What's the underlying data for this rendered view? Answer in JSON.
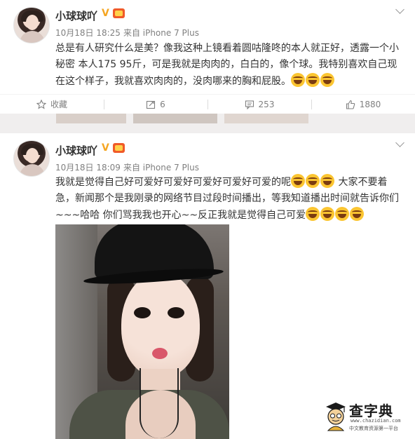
{
  "posts": [
    {
      "username": "小球球吖",
      "time": "10月18日 18:25",
      "source": "来自 iPhone 7 Plus",
      "text": "总是有人研究什么是美？像我这种上镜看着圆咕隆咚的本人就正好，透露一个小秘密 本人175 95斤，可是我就是肉肉的，白白的，像个球。我特别喜欢自己现在这个样子，我就喜欢肉肉的，没肉哪来的胸和屁股。",
      "emoji_count": 3,
      "actions": {
        "favorite": "收藏",
        "repost": "6",
        "comment": "253",
        "like": "1880"
      }
    },
    {
      "username": "小球球吖",
      "time": "10月18日 18:09",
      "source": "来自 iPhone 7 Plus",
      "text_a": "我就是觉得自己好可爱好可爱好可爱好可爱好可爱的呢",
      "text_b": " 大家不要着急，新闻那个是我刚录的网络节目过段时间播出，等我知道播出时间就告诉你们~~~哈哈 你们骂我我也开心~~反正我就是觉得自己可爱",
      "emoji_a": 3,
      "emoji_b": 4
    }
  ],
  "watermark": {
    "title": "查字典",
    "url": "www.chazidian.com",
    "subtitle": "中文教育资源第一平台"
  },
  "icons": [
    "star-icon",
    "repost-icon",
    "comment-icon",
    "like-icon",
    "chevron-down-icon",
    "verified-v-icon",
    "member-badge-icon",
    "laugh-cry-emoji"
  ],
  "colors": {
    "accent_v": "#f5a623",
    "muted": "#808080",
    "text": "#333333"
  }
}
